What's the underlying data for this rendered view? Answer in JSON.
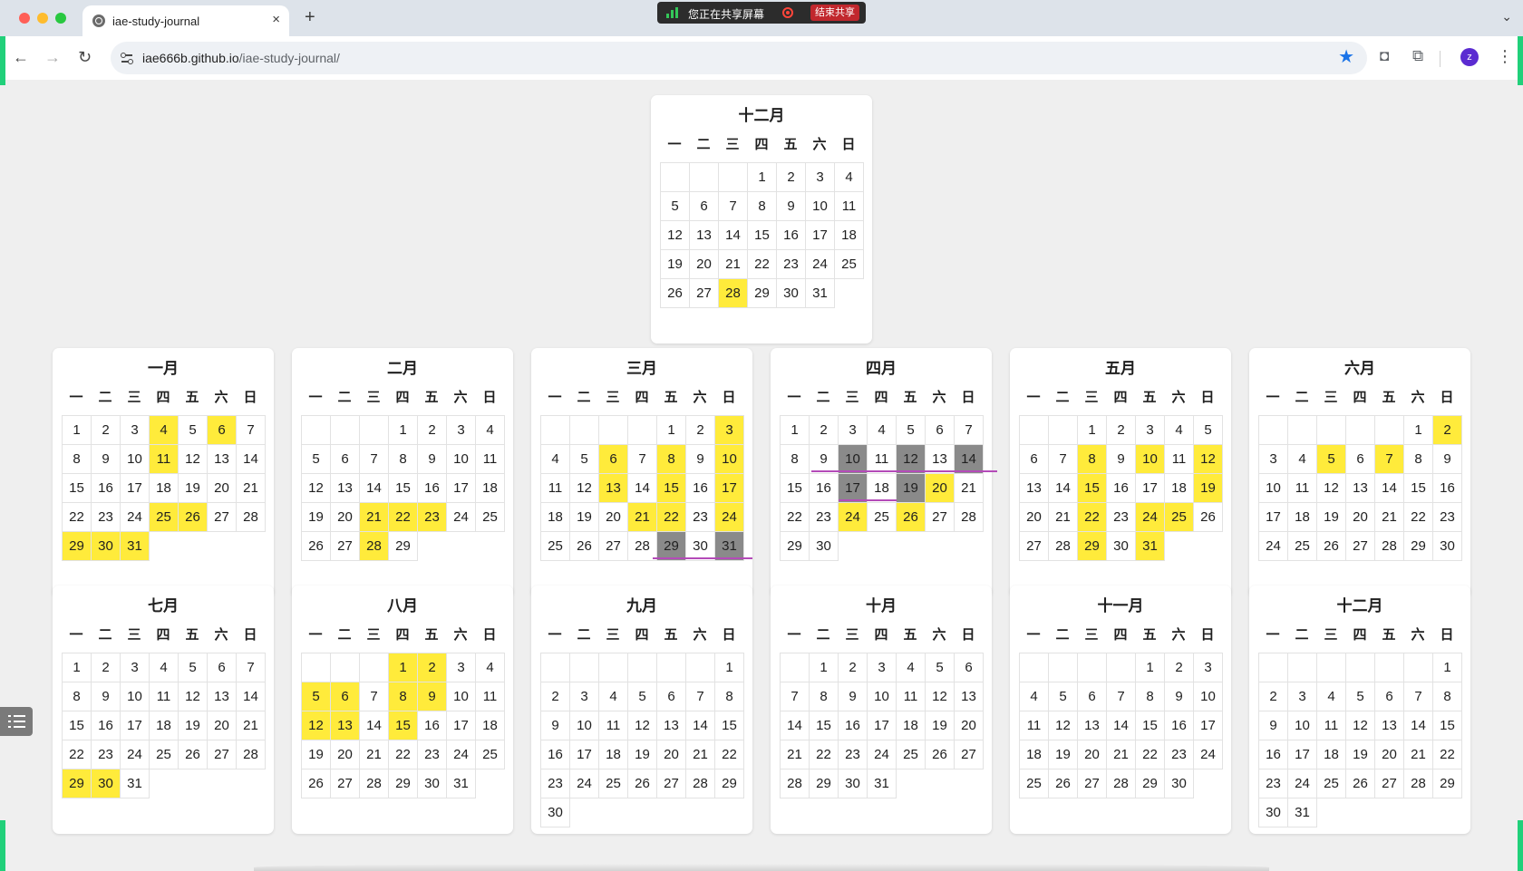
{
  "browser": {
    "tab_title": "iae-study-journal",
    "tab_close": "×",
    "new_tab": "+",
    "tab_menu": "⌄",
    "url_host": "iae666b.github.io",
    "url_path": "/iae-study-journal/",
    "avatar_letter": "z",
    "nav_back": "←",
    "nav_forward": "→",
    "nav_reload": "↻",
    "star": "★",
    "camera": "◘",
    "extensions": "⧉",
    "menu": "⋮"
  },
  "screen_share": {
    "status_text": "您正在共享屏幕",
    "stop_label": "结束共享"
  },
  "weekday_headers": [
    "一",
    "二",
    "三",
    "四",
    "五",
    "六",
    "日"
  ],
  "months": [
    {
      "id": "prev-dec",
      "title": "十二月",
      "offset": 3,
      "days": 31,
      "highlight": [
        28
      ],
      "dark": []
    },
    {
      "id": "jan",
      "title": "一月",
      "offset": 0,
      "days": 31,
      "highlight": [
        4,
        6,
        11,
        25,
        26,
        29,
        30,
        31
      ],
      "dark": []
    },
    {
      "id": "feb",
      "title": "二月",
      "offset": 3,
      "days": 29,
      "highlight": [
        21,
        22,
        23,
        28
      ],
      "dark": []
    },
    {
      "id": "mar",
      "title": "三月",
      "offset": 4,
      "days": 31,
      "highlight": [
        3,
        6,
        8,
        10,
        13,
        15,
        17,
        21,
        22,
        24
      ],
      "dark": [
        29,
        31
      ]
    },
    {
      "id": "apr",
      "title": "四月",
      "offset": 0,
      "days": 30,
      "highlight": [
        20,
        24,
        26
      ],
      "dark": [
        10,
        12,
        14,
        17,
        19
      ]
    },
    {
      "id": "may",
      "title": "五月",
      "offset": 2,
      "days": 31,
      "highlight": [
        8,
        10,
        12,
        15,
        19,
        22,
        24,
        25,
        29,
        31
      ],
      "dark": []
    },
    {
      "id": "jun",
      "title": "六月",
      "offset": 5,
      "days": 30,
      "highlight": [
        2,
        5,
        7
      ],
      "dark": []
    },
    {
      "id": "jul",
      "title": "七月",
      "offset": 0,
      "days": 31,
      "highlight": [
        29,
        30
      ],
      "dark": []
    },
    {
      "id": "aug",
      "title": "八月",
      "offset": 3,
      "days": 31,
      "highlight": [
        1,
        2,
        5,
        6,
        8,
        9,
        12,
        13,
        15
      ],
      "dark": []
    },
    {
      "id": "sep",
      "title": "九月",
      "offset": 6,
      "days": 30,
      "highlight": [],
      "dark": []
    },
    {
      "id": "oct",
      "title": "十月",
      "offset": 1,
      "days": 31,
      "highlight": [],
      "dark": []
    },
    {
      "id": "nov",
      "title": "十一月",
      "offset": 4,
      "days": 30,
      "highlight": [],
      "dark": []
    },
    {
      "id": "dec",
      "title": "十二月",
      "offset": 6,
      "days": 31,
      "highlight": [],
      "dark": []
    }
  ],
  "colors": {
    "highlight": "#ffeb3b",
    "dark": "#8a8a8a",
    "streak_line": "#b44bb8",
    "page_background": "#efefef"
  },
  "icons": {
    "toc_button": "list-icon"
  }
}
